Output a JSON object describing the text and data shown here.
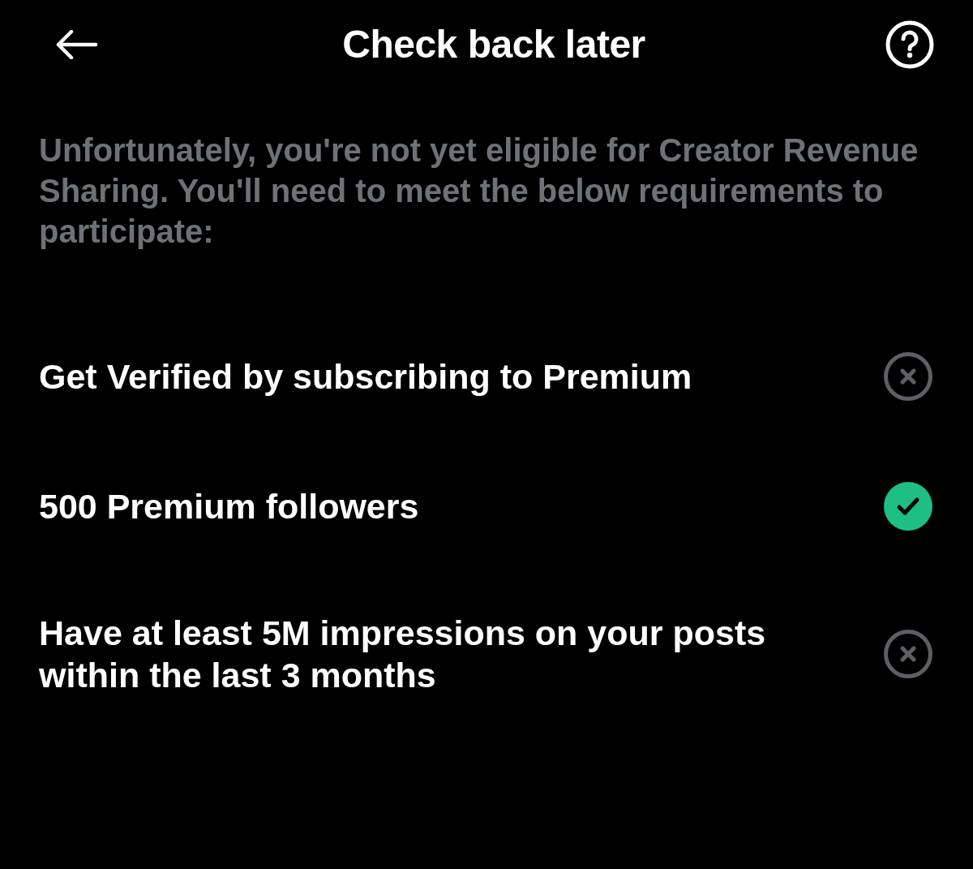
{
  "header": {
    "title": "Check back later"
  },
  "intro": "Unfortunately, you're not yet eligible for Creator Revenue Sharing. You'll need to meet the below requirements to participate:",
  "requirements": [
    {
      "text": "Get Verified by subscribing to Premium",
      "met": false
    },
    {
      "text": "500 Premium followers",
      "met": true
    },
    {
      "text": "Have at least 5M impressions on your posts within the last 3 months",
      "met": false
    }
  ]
}
